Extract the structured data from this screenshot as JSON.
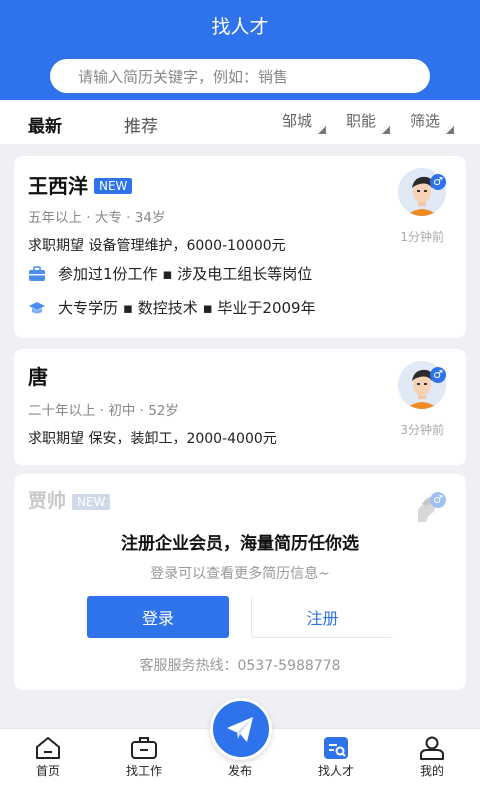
{
  "header": {
    "title": "找人才"
  },
  "search": {
    "placeholder": "请输入简历关键字，例如：销售"
  },
  "tabs": {
    "latest": "最新",
    "recommend": "推荐"
  },
  "filters": {
    "city": "邹城",
    "job": "职能",
    "filter": "筛选"
  },
  "cards": [
    {
      "name": "王西洋",
      "badge": "NEW",
      "meta": "五年以上 · 大专 · 34岁",
      "expect": "求职期望 设备管理维护，6000-10000元",
      "work": "参加过1份工作 ▪ 涉及电工组长等岗位",
      "edu": "大专学历 ▪ 数控技术 ▪ 毕业于2009年",
      "time": "1分钟前",
      "gender": "♂"
    },
    {
      "name": "唐",
      "meta": "二十年以上 · 初中 · 52岁",
      "expect": "求职期望 保安，装卸工，2000-4000元",
      "time": "3分钟前",
      "gender": "♂"
    },
    {
      "name": "贾帅",
      "badge": "NEW",
      "gender": "♂"
    }
  ],
  "promo": {
    "title": "注册企业会员，海量简历任你选",
    "subtitle": "登录可以查看更多简历信息~",
    "login": "登录",
    "register": "注册",
    "hotline": "客服服务热线：0537-5988778"
  },
  "nav": [
    {
      "label": "首页",
      "icon": "home-icon"
    },
    {
      "label": "找工作",
      "icon": "briefcase-icon"
    },
    {
      "label": "发布",
      "icon": "send-icon"
    },
    {
      "label": "找人才",
      "icon": "search-talent-icon"
    },
    {
      "label": "我的",
      "icon": "user-icon"
    }
  ],
  "colors": {
    "accent": "#2f73ec"
  }
}
